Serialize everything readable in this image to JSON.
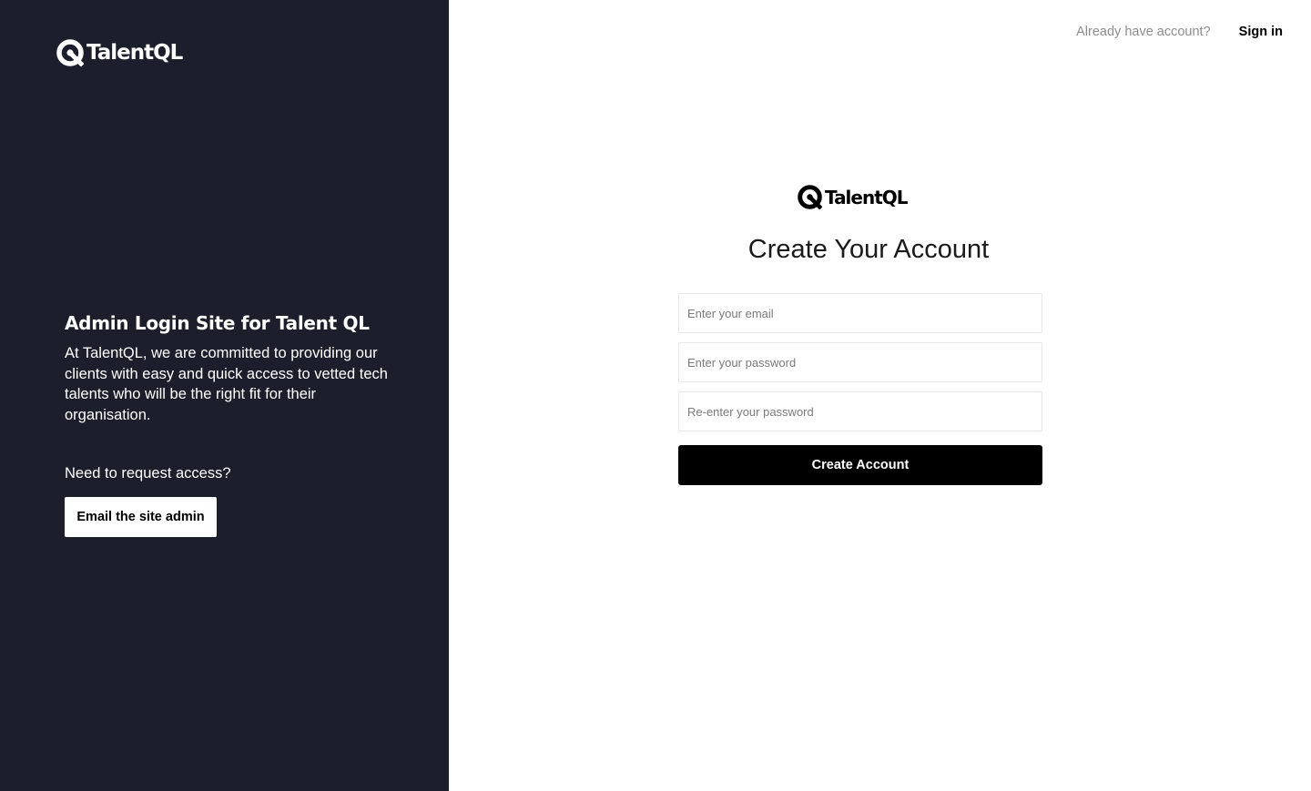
{
  "brand": {
    "name": "TalentQL"
  },
  "left_panel": {
    "title": "Admin Login Site for Talent QL",
    "description": "At TalentQL, we are committed to providing our clients with easy and quick access to vetted tech talents who will be the right fit for their organisation.",
    "request_prompt": "Need to request access?",
    "email_admin_label": "Email the site admin"
  },
  "header": {
    "already_text": "Already have account?",
    "signin_label": "Sign in"
  },
  "form": {
    "title": "Create Your Account",
    "email_placeholder": "Enter your email",
    "password_placeholder": "Enter your password",
    "confirm_placeholder": "Re-enter your password",
    "submit_label": "Create Account"
  },
  "colors": {
    "panel_bg": "#1c1e2c",
    "primary_button": "#000000"
  },
  "icons": {
    "logo_mark": "talentql-logo-icon"
  }
}
